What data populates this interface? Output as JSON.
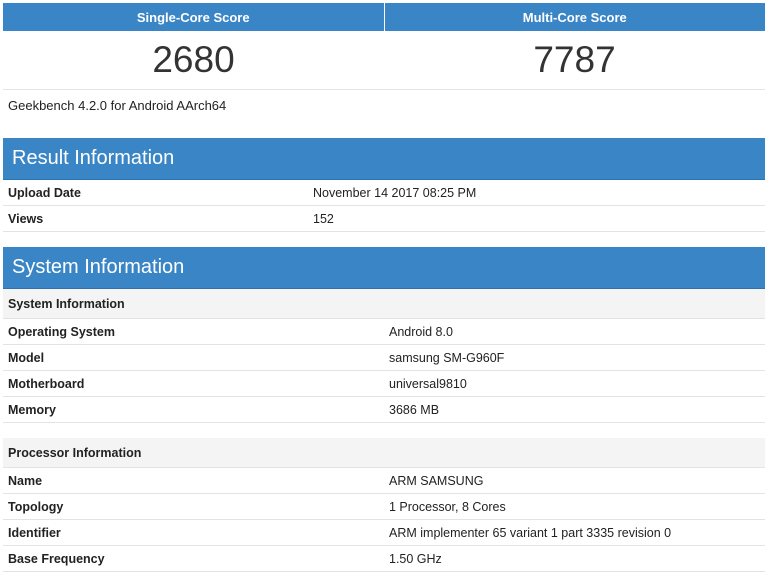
{
  "scores": {
    "single_label": "Single-Core Score",
    "multi_label": "Multi-Core Score",
    "single_value": "2680",
    "multi_value": "7787"
  },
  "version": "Geekbench 4.2.0 for Android AArch64",
  "result_info": {
    "title": "Result Information",
    "rows": [
      {
        "key": "Upload Date",
        "value": "November 14 2017 08:25 PM"
      },
      {
        "key": "Views",
        "value": "152"
      }
    ]
  },
  "system_info": {
    "title": "System Information",
    "system_section": {
      "heading": "System Information",
      "rows": [
        {
          "key": "Operating System",
          "value": "Android 8.0"
        },
        {
          "key": "Model",
          "value": "samsung SM-G960F"
        },
        {
          "key": "Motherboard",
          "value": "universal9810"
        },
        {
          "key": "Memory",
          "value": "3686 MB"
        }
      ]
    },
    "processor_section": {
      "heading": "Processor Information",
      "rows": [
        {
          "key": "Name",
          "value": "ARM SAMSUNG"
        },
        {
          "key": "Topology",
          "value": "1 Processor, 8 Cores"
        },
        {
          "key": "Identifier",
          "value": "ARM implementer 65 variant 1 part 3335 revision 0"
        },
        {
          "key": "Base Frequency",
          "value": "1.50 GHz"
        }
      ]
    }
  },
  "colors": {
    "header_blue": "#3a85c6",
    "row_border": "#e3e3e3",
    "subhead_bg": "#f4f4f4"
  }
}
